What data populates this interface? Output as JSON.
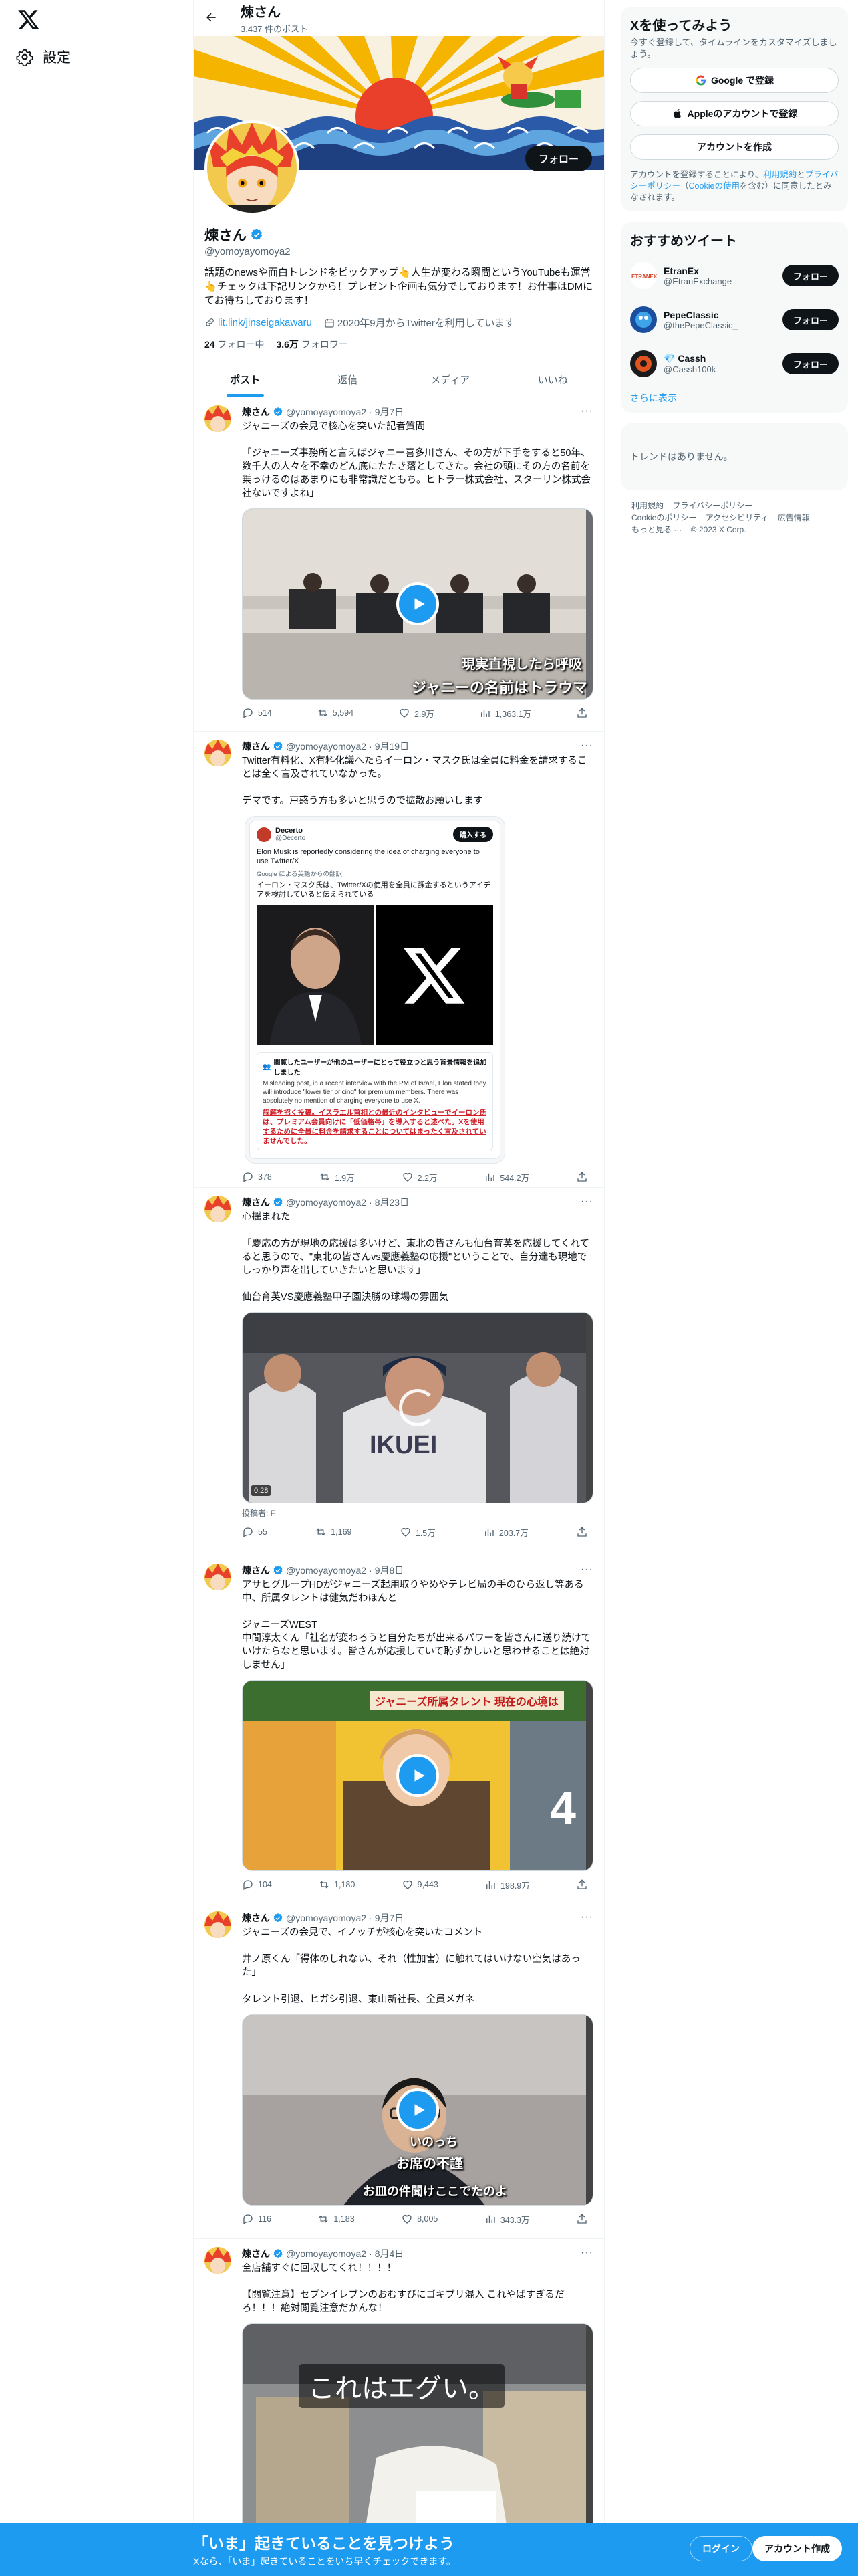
{
  "nav": {
    "settings_label": "設定"
  },
  "header": {
    "name": "煉さん",
    "post_count": "3,437 件のポスト"
  },
  "profile": {
    "name": "煉さん",
    "handle": "@yomoyayomoya2",
    "follow_label": "フォロー",
    "bio": "話題のnewsや面白トレンドをピックアップ👆人生が変わる瞬間というYouTubeも運営👆チェックは下記リンクから！プレゼント企画も気分でしております！お仕事はDMにてお待ちしております！",
    "link": "lit.link/jinseigakawaru",
    "joined": "2020年9月からTwitterを利用しています",
    "following_count": "24",
    "following_label": "フォロー中",
    "followers_count": "3.6万",
    "followers_label": "フォロワー"
  },
  "tabs": [
    "ポスト",
    "返信",
    "メディア",
    "いいね"
  ],
  "tweets": [
    {
      "name": "煉さん",
      "handle": "@yomoyayomoya2",
      "date": "9月7日",
      "text": "ジャニーズの会見で核心を突いた記者質問\n\n「ジャニーズ事務所と言えばジャニー喜多川さん、その方が下手をすると50年、数千人の人々を不幸のどん底にたたき落としてきた。会社の頭にその方の名前を乗っけるのはあまりにも非常識だともち。ヒトラー株式会社、スターリン株式会社ないですよね」",
      "caption1": "現実直視したら呼吸",
      "caption2": "ジャニーの名前はトラウマ",
      "replies": "514",
      "reposts": "5,594",
      "likes": "2.9万",
      "views": "1,363.1万"
    },
    {
      "name": "煉さん",
      "handle": "@yomoyayomoya2",
      "date": "9月19日",
      "text": "Twitter有料化、X有料化議へたらイーロン・マスク氏は全員に料金を請求することは全く言及されていなかった。\n\nデマです。戸惑う方も多いと思うので拡散お願いします",
      "embed_site": "Decerto",
      "embed_handle": "@Decerto",
      "embed_btn": "購入する",
      "embed_en": "Elon Musk is reportedly considering the idea of charging everyone to use Twitter/X",
      "embed_tr_label": "Google による英語からの翻訳",
      "embed_jp": "イーロン・マスク氏は、Twitter/Xの使用を全員に課金するというアイデアを検討していると伝えられている",
      "embed_note_title": "閲覧したユーザーが他のユーザーにとって役立つと思う背景情報を追加しました",
      "embed_note_en": "Misleading post, in a recent interview with the PM of Israel, Elon stated they will introduce \"lower tier pricing\" for premium members. There was absolutely no mention of charging everyone to use X.",
      "embed_note_jp": "誤解を招く投稿。イスラエル首相との最近のインタビューでイーロン氏は、プレミアム会員向けに「低価格帯」を導入すると述べた。Xを使用するために全員に料金を請求することについてはまったく言及されていませんでした。",
      "replies": "378",
      "reposts": "1.9万",
      "likes": "2.2万",
      "views": "544.2万"
    },
    {
      "name": "煉さん",
      "handle": "@yomoyayomoya2",
      "date": "8月23日",
      "text": "心揺まれた\n\n「慶応の方が現地の応援は多いけど、東北の皆さんも仙台育英を応援してくれてると思うので、\"東北の皆さんvs慶應義塾の応援\"ということで、自分達も現地でしっかり声を出していきたいと思います」\n\n仙台育英VS慶應義塾甲子園決勝の球場の雰囲気",
      "video_time": "0:28",
      "credit": "投稿者: F",
      "replies": "55",
      "reposts": "1,169",
      "likes": "1.5万",
      "views": "203.7万"
    },
    {
      "name": "煉さん",
      "handle": "@yomoyayomoya2",
      "date": "9月8日",
      "text": "アサヒグループHDがジャニーズ起用取りやめやテレビ局の手のひら返し等ある中、所属タレントは健気だわほんと\n\nジャニーズWEST\n中間淳太くん「社名が変わろうと自分たちが出来るパワーを皆さんに送り続けていけたらなと思います。皆さんが応援していて恥ずかしいと思わせることは絶対しません」",
      "tv_title": "ジャニーズ所属タレント 現在の心境は",
      "replies": "104",
      "reposts": "1,180",
      "likes": "9,443",
      "views": "198.9万"
    },
    {
      "name": "煉さん",
      "handle": "@yomoyayomoya2",
      "date": "9月7日",
      "text": "ジャニーズの会見で、イノッチが核心を突いたコメント\n\n井ノ原くん「得体のしれない、それ（性加害）に触れてはいけない空気はあった」\n\nタレント引退、ヒガシ引退、東山新社長、全員メガネ",
      "caption1": "いのっち",
      "caption2": "お席の不謹",
      "caption3": "お皿の件聞けここでたのよ",
      "replies": "116",
      "reposts": "1,183",
      "likes": "8,005",
      "views": "343.3万"
    },
    {
      "name": "煉さん",
      "handle": "@yomoyayomoya2",
      "date": "8月4日",
      "text": "全店舗すぐに回収してくれ！！！！\n\n【閲覧注意】セブンイレブンのおむすびにゴキブリ混入 これやばすぎるだろ！！！絶対閲覧注意だかんな！",
      "caption1": "これはエグい。"
    }
  ],
  "sidebar": {
    "signup_title": "Xを使ってみよう",
    "signup_sub": "今すぐ登録して、タイムラインをカスタマイズしましょう。",
    "google_label": "Google で登録",
    "apple_label": "Appleのアカウントで登録",
    "create_label": "アカウントを作成",
    "legal_1": "アカウントを登録することにより、",
    "legal_terms": "利用規約",
    "legal_2": "と",
    "legal_privacy": "プライバシーポリシー",
    "legal_3": "（",
    "legal_cookie": "Cookieの使用",
    "legal_4": "を含む）に同意したとみなされます。",
    "rec_title": "おすすめツイート",
    "recs": [
      {
        "name": "EtranEx",
        "handle": "@EtranExchange",
        "btn": "フォロー"
      },
      {
        "name": "PepeClassic",
        "handle": "@thePepeClassic_",
        "btn": "フォロー"
      },
      {
        "name": "💎 Cassh",
        "handle": "@Cassh100k",
        "btn": "フォロー"
      }
    ],
    "show_more": "さらに表示",
    "trends_empty": "トレンドはありません。",
    "footer_1": "利用規約",
    "footer_2": "プライバシーポリシー",
    "footer_3": "Cookieのポリシー",
    "footer_4": "アクセシビリティ",
    "footer_5": "広告情報",
    "footer_6": "もっと見る ···",
    "footer_7": "© 2023 X Corp."
  },
  "bottombar": {
    "title": "「いま」起きていることを見つけよう",
    "sub": "Xなら、「いま」起きていることをいち早くチェックできます。",
    "login": "ログイン",
    "signup": "アカウント作成"
  },
  "colors": {
    "accent": "#1d9bf0",
    "text": "#0f1419",
    "muted": "#536471",
    "border": "#eff3f4"
  }
}
